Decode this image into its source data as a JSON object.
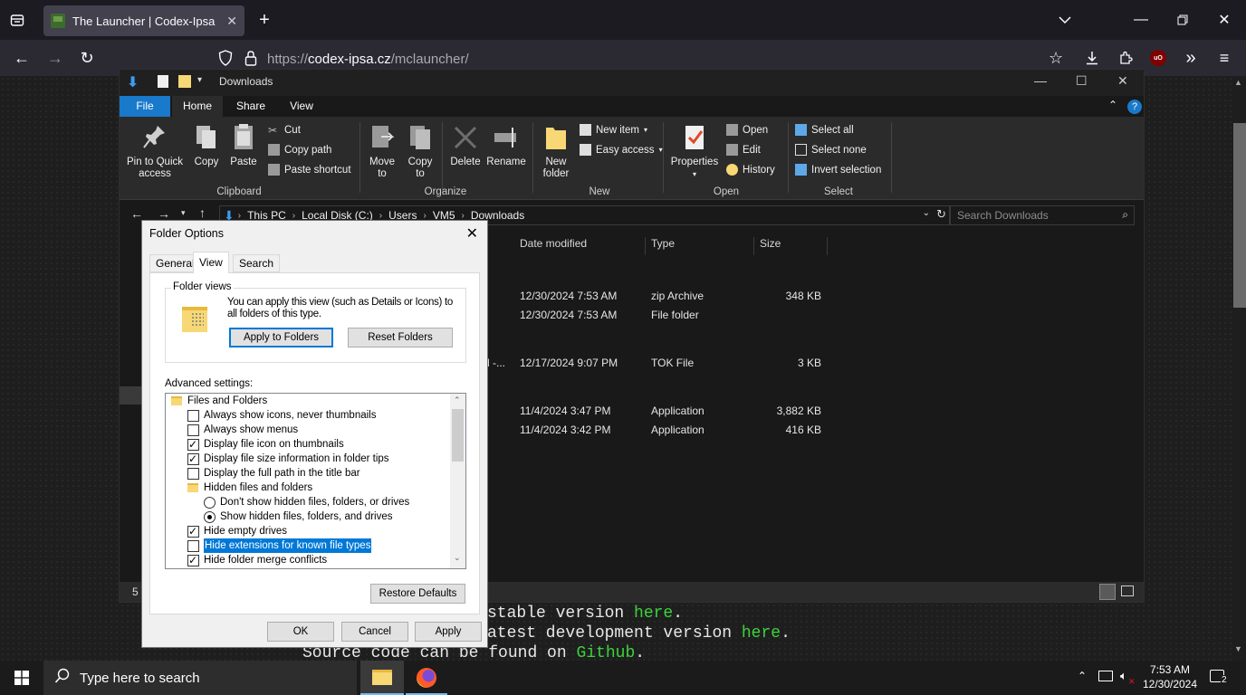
{
  "browser": {
    "tab_title": "The Launcher | Codex-Ipsa",
    "url_dim": "https://",
    "url_host": "codex-ipsa.cz",
    "url_path": "/mclauncher/"
  },
  "page": {
    "line1_prefix": "stable version ",
    "line1_link": "here",
    "line1_suffix": ".",
    "line2_prefix": "atest development version ",
    "line2_link": "here",
    "line2_suffix": ".",
    "line3_prefix": "Source code can be found on ",
    "line3_link": "Github",
    "line3_suffix": "."
  },
  "explorer": {
    "title": "Downloads",
    "ribbon_tabs": [
      "File",
      "Home",
      "Share",
      "View"
    ],
    "clipboard": {
      "pin": "Pin to Quick access",
      "copy": "Copy",
      "paste": "Paste",
      "cut": "Cut",
      "copy_path": "Copy path",
      "paste_shortcut": "Paste shortcut",
      "group": "Clipboard"
    },
    "organize": {
      "move_to": "Move to",
      "copy_to": "Copy to",
      "delete": "Delete",
      "rename": "Rename",
      "group": "Organize"
    },
    "new": {
      "new_folder": "New folder",
      "new_item": "New item",
      "easy_access": "Easy access",
      "group": "New"
    },
    "open": {
      "properties": "Properties",
      "open": "Open",
      "edit": "Edit",
      "history": "History",
      "group": "Open"
    },
    "select": {
      "select_all": "Select all",
      "select_none": "Select none",
      "invert": "Invert selection",
      "group": "Select"
    },
    "breadcrumbs": [
      "This PC",
      "Local Disk (C:)",
      "Users",
      "VM5",
      "Downloads"
    ],
    "search_placeholder": "Search Downloads",
    "columns": [
      "Date modified",
      "Type",
      "Size"
    ],
    "rows": [
      {
        "name": "",
        "date": "12/30/2024 7:53 AM",
        "type": "zip Archive",
        "size": "348 KB"
      },
      {
        "name": "",
        "date": "12/30/2024 7:53 AM",
        "type": "File folder",
        "size": ""
      },
      {
        "name": "l -...",
        "date": "12/17/2024 9:07 PM",
        "type": "TOK File",
        "size": "3 KB"
      },
      {
        "name": "",
        "date": "11/4/2024 3:47 PM",
        "type": "Application",
        "size": "3,882 KB"
      },
      {
        "name": "",
        "date": "11/4/2024 3:42 PM",
        "type": "Application",
        "size": "416 KB"
      }
    ],
    "status_count": "5"
  },
  "dialog": {
    "title": "Folder Options",
    "tabs": [
      "General",
      "View",
      "Search"
    ],
    "folder_views_legend": "Folder views",
    "folder_views_text": "You can apply this view (such as Details or Icons) to all folders of this type.",
    "apply_to_folders": "Apply to Folders",
    "reset_folders": "Reset Folders",
    "advanced_label": "Advanced settings:",
    "tree": [
      {
        "kind": "folder",
        "label": "Files and Folders",
        "checked": false,
        "level": 0
      },
      {
        "kind": "check",
        "label": "Always show icons, never thumbnails",
        "checked": false,
        "level": 1
      },
      {
        "kind": "check",
        "label": "Always show menus",
        "checked": false,
        "level": 1
      },
      {
        "kind": "check",
        "label": "Display file icon on thumbnails",
        "checked": true,
        "level": 1
      },
      {
        "kind": "check",
        "label": "Display file size information in folder tips",
        "checked": true,
        "level": 1
      },
      {
        "kind": "check",
        "label": "Display the full path in the title bar",
        "checked": false,
        "level": 1
      },
      {
        "kind": "folder",
        "label": "Hidden files and folders",
        "checked": false,
        "level": 1
      },
      {
        "kind": "radio",
        "label": "Don't show hidden files, folders, or drives",
        "checked": false,
        "level": 2
      },
      {
        "kind": "radio",
        "label": "Show hidden files, folders, and drives",
        "checked": true,
        "level": 2
      },
      {
        "kind": "check",
        "label": "Hide empty drives",
        "checked": true,
        "level": 1
      },
      {
        "kind": "check",
        "label": "Hide extensions for known file types",
        "checked": false,
        "level": 1,
        "selected": true
      },
      {
        "kind": "check",
        "label": "Hide folder merge conflicts",
        "checked": true,
        "level": 1
      }
    ],
    "restore_defaults": "Restore Defaults",
    "ok": "OK",
    "cancel": "Cancel",
    "apply": "Apply"
  },
  "taskbar": {
    "search_placeholder": "Type here to search",
    "time": "7:53 AM",
    "date": "12/30/2024",
    "notif_count": "2"
  }
}
